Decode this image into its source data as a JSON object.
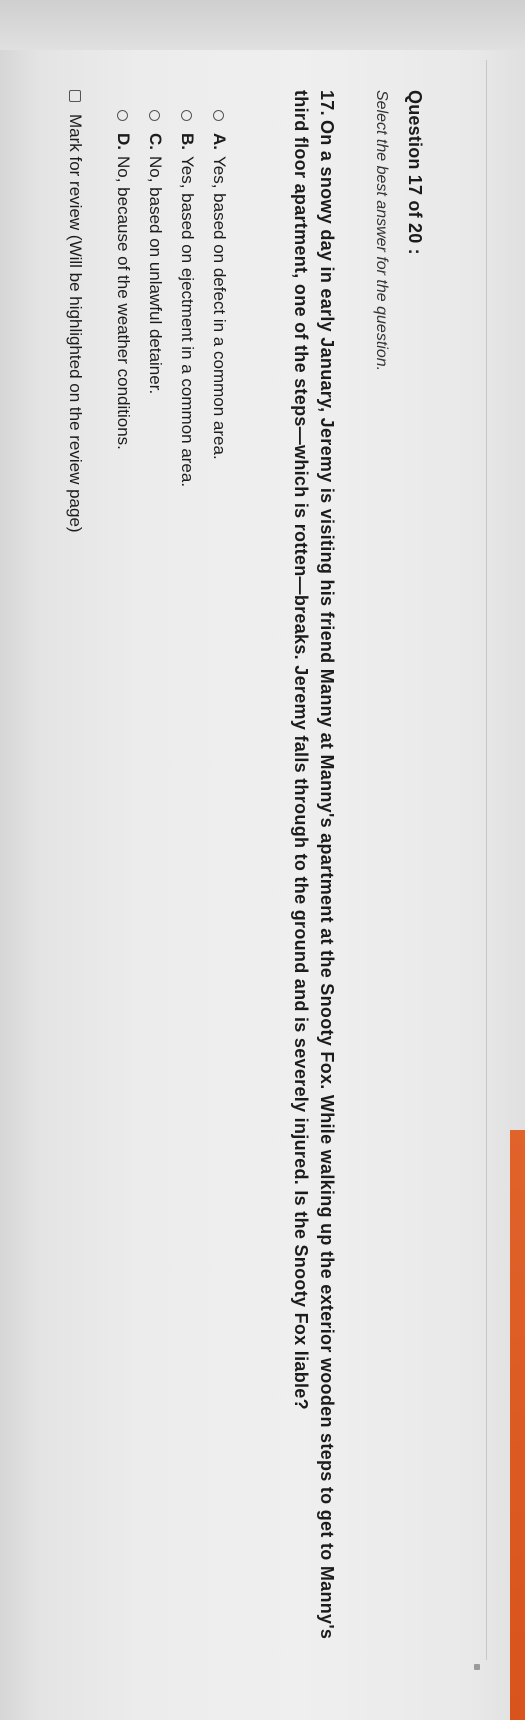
{
  "question_header": {
    "title": "Question 17 of 20 :",
    "instructions": "Select the best answer for the question."
  },
  "question": {
    "number": "17.",
    "text": "On a snowy day in early January, Jeremy is visiting his friend Manny at Manny's apartment at the Snooty Fox. While walking up the exterior wooden steps to get to Manny's third floor apartment, one of the steps—which is rotten—breaks. Jeremy falls through to the ground and is severely injured. Is the Snooty Fox liable?"
  },
  "options": [
    {
      "letter": "A.",
      "text": "Yes, based on defect in a common area."
    },
    {
      "letter": "B.",
      "text": "Yes, based on ejectment in a common area."
    },
    {
      "letter": "C.",
      "text": "No, based on unlawful detainer."
    },
    {
      "letter": "D.",
      "text": "No, because of the weather conditions."
    }
  ],
  "review": {
    "label": "Mark for review (Will be highlighted on the review page)"
  },
  "colors": {
    "accent_tab": "#e0632a",
    "page_background": "#ececec"
  }
}
